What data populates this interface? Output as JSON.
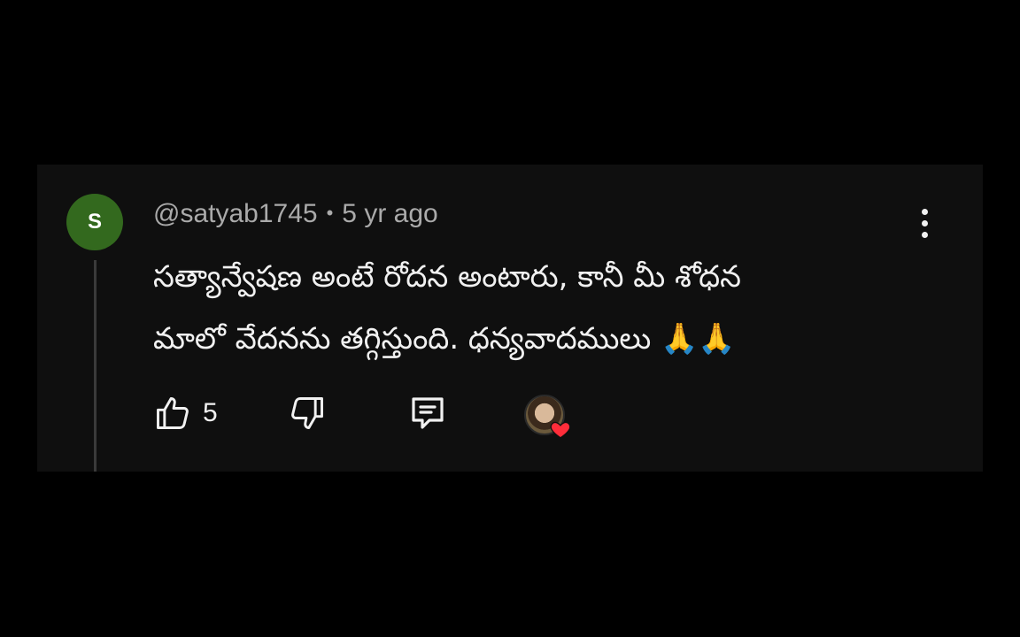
{
  "comment": {
    "avatar_letter": "S",
    "avatar_color": "#33691e",
    "username": "@satyab1745",
    "separator": "•",
    "timestamp": "5 yr ago",
    "text_line1": "సత్యాన్వేషణ అంటే రోదన అంటారు, కానీ మీ శోధన",
    "text_line2": "మాలో వేదనను తగ్గిస్తుంది. ధన్యవాదములు 🙏🙏",
    "like_count": "5",
    "icons": {
      "like": "thumbs-up-icon",
      "dislike": "thumbs-down-icon",
      "reply": "reply-comment-icon",
      "creator_heart": "heart-icon",
      "more": "more-vert-icon"
    },
    "heart_color": "#ff2d3a"
  }
}
